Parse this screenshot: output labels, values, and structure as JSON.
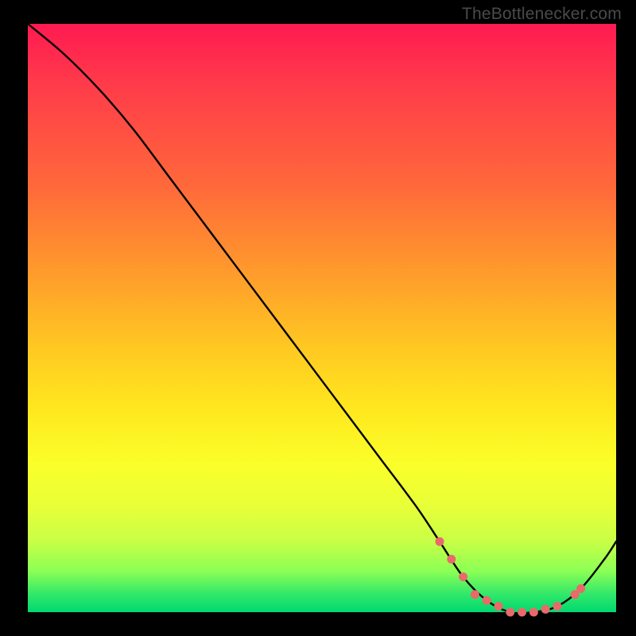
{
  "watermark": "TheBottlenecker.com",
  "chart_data": {
    "type": "line",
    "title": "",
    "xlabel": "",
    "ylabel": "",
    "xlim": [
      0,
      100
    ],
    "ylim": [
      0,
      100
    ],
    "series": [
      {
        "name": "bottleneck-curve",
        "x": [
          0,
          6,
          12,
          18,
          24,
          30,
          36,
          42,
          48,
          54,
          60,
          66,
          70,
          74,
          78,
          82,
          86,
          90,
          94,
          98,
          100
        ],
        "y": [
          100,
          95,
          89,
          82,
          74,
          66,
          58,
          50,
          42,
          34,
          26,
          18,
          12,
          6,
          2,
          0,
          0,
          1,
          4,
          9,
          12
        ]
      }
    ],
    "marker_points": {
      "name": "highlight-dots",
      "x": [
        70,
        72,
        74,
        76,
        78,
        80,
        82,
        84,
        86,
        88,
        90,
        93,
        94
      ],
      "y": [
        12,
        9,
        6,
        3,
        2,
        1,
        0,
        0,
        0,
        0.5,
        1,
        3,
        4
      ]
    },
    "gradient_stops": [
      {
        "pos": 0.0,
        "color": "#ff1a52"
      },
      {
        "pos": 0.28,
        "color": "#ff6a3a"
      },
      {
        "pos": 0.55,
        "color": "#ffc822"
      },
      {
        "pos": 0.75,
        "color": "#faff2a"
      },
      {
        "pos": 0.93,
        "color": "#8cff55"
      },
      {
        "pos": 1.0,
        "color": "#00d870"
      }
    ]
  }
}
